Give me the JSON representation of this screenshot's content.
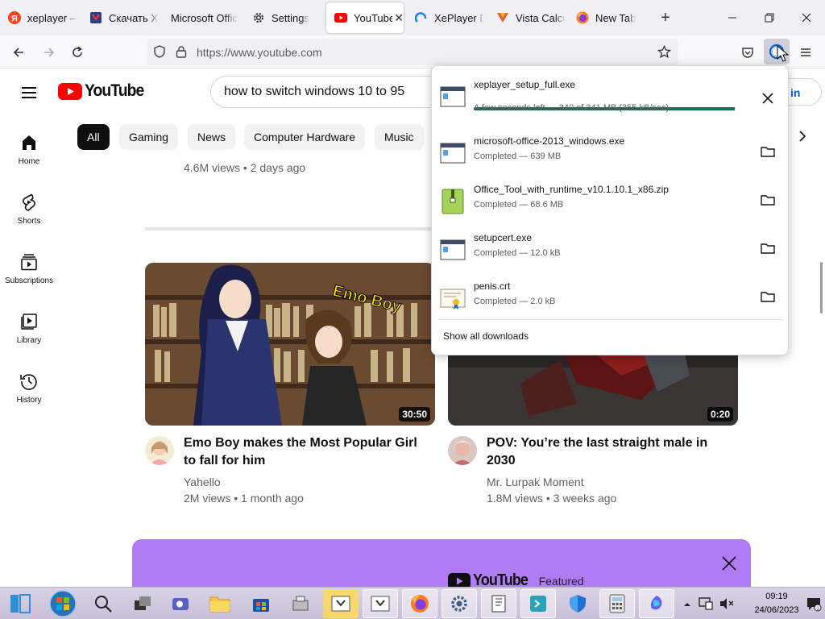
{
  "browser": {
    "tabs": [
      {
        "title": "xeplayer —",
        "icon": "yandex-icon",
        "active": false
      },
      {
        "title": "Скачать Xe",
        "icon": "shield-site-icon",
        "active": false
      },
      {
        "title": "Microsoft Offic",
        "icon": "none",
        "active": false
      },
      {
        "title": "Settings",
        "icon": "gear-icon",
        "active": false
      },
      {
        "title": "YouTube",
        "icon": "youtube-icon",
        "active": true
      },
      {
        "title": "XePlayer Di",
        "icon": "xeplayer-icon",
        "active": false
      },
      {
        "title": "Vista Calcu",
        "icon": "vista-icon",
        "active": false
      },
      {
        "title": "New Tab",
        "icon": "firefox-icon",
        "active": false
      }
    ],
    "new_tab_label": "+",
    "url": "https://www.youtube.com",
    "colors": {
      "tabbar": "#f0f0f4",
      "toolbar": "#f9f9fb"
    }
  },
  "youtube": {
    "logo_text": "YouTube",
    "search_query": "how to switch windows 10 to 95",
    "sign_in_label": "in",
    "sidebar": [
      {
        "label": "Home",
        "icon": "home-icon"
      },
      {
        "label": "Shorts",
        "icon": "shorts-icon"
      },
      {
        "label": "Subscriptions",
        "icon": "subscriptions-icon"
      },
      {
        "label": "Library",
        "icon": "library-icon"
      },
      {
        "label": "History",
        "icon": "history-icon"
      }
    ],
    "chips": [
      "All",
      "Gaming",
      "News",
      "Computer Hardware",
      "Music"
    ],
    "top_video_meta": "4.6M views • 2 days ago",
    "videos": [
      {
        "title": "Emo Boy makes the Most Popular Girl to fall for him",
        "channel": "Yahello",
        "meta": "2M views • 1 month ago",
        "duration": "30:50",
        "thumbnail_text": "Emo Boy"
      },
      {
        "title": "POV: You’re the last straight male in 2030",
        "channel": "Mr. Lurpak Moment",
        "meta": "1.8M views • 3 weeks ago",
        "duration": "0:20"
      }
    ],
    "promo": {
      "logo_text": "YouTube",
      "label": "Featured",
      "color": "#b07cf5"
    }
  },
  "downloads": {
    "items": [
      {
        "name": "xeplayer_setup_full.exe",
        "status": "A few seconds left — 340 of 341 MB (355 kB/sec)",
        "progress": 0.997,
        "icon": "exe-file-icon",
        "action": "cancel"
      },
      {
        "name": "microsoft-office-2013_windows.exe",
        "status": "Completed — 639 MB",
        "icon": "exe-file-icon",
        "action": "folder"
      },
      {
        "name": "Office_Tool_with_runtime_v10.1.10.1_x86.zip",
        "status": "Completed — 68.6 MB",
        "icon": "zip-file-icon",
        "action": "folder"
      },
      {
        "name": "setupcert.exe",
        "status": "Completed — 12.0 kB",
        "icon": "exe-file-icon",
        "action": "folder"
      },
      {
        "name": "penis.crt",
        "status": "Completed — 2.0 kB",
        "icon": "certificate-file-icon",
        "action": "folder"
      }
    ],
    "show_all_label": "Show all downloads",
    "progress_color": "#1e6e4e"
  },
  "taskbar": {
    "time": "09:19",
    "date": "24/06/2023"
  }
}
